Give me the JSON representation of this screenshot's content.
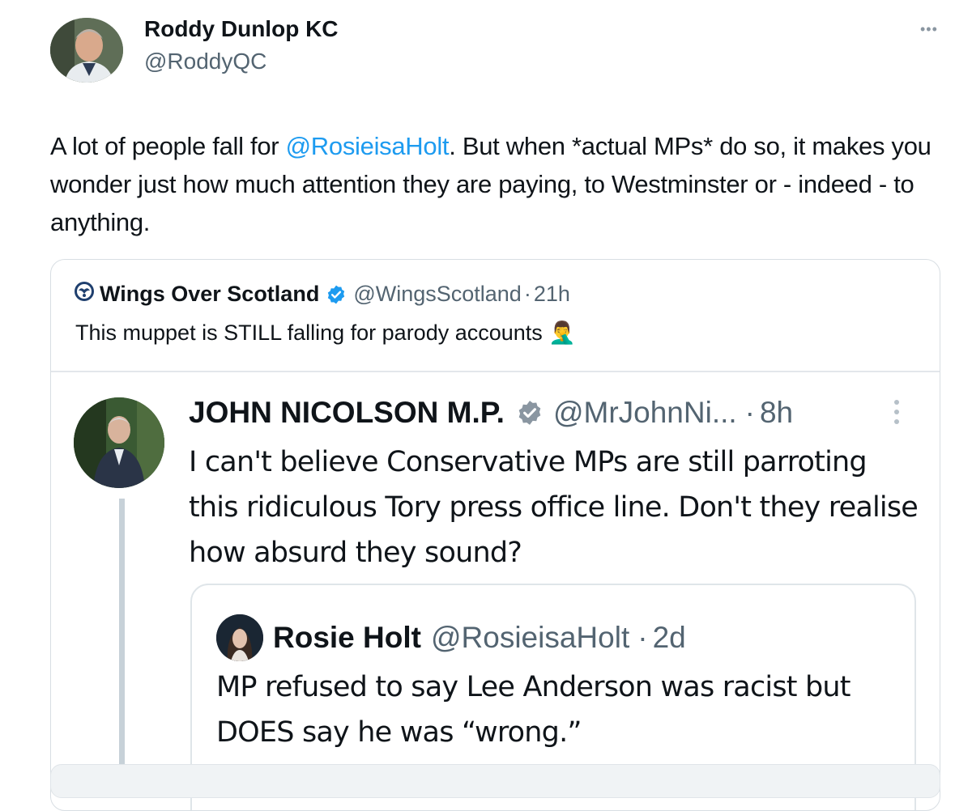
{
  "tweet": {
    "author_name": "Roddy Dunlop KC",
    "author_handle": "@RoddyQC",
    "more_icon": "more-dots-icon",
    "text_before_mention": "A lot of people fall for ",
    "mention": "@RosieisaHolt",
    "text_after_mention": ". But when *actual MPs* do so, it makes you wonder just how much attention they are paying, to Westminster or - indeed - to anything."
  },
  "quoted_tweet": {
    "author_name": "Wings Over Scotland",
    "author_handle": "@WingsScotland",
    "separator": "·",
    "time": "21h",
    "text": "This muppet is STILL falling for parody accounts",
    "emoji": "🤦‍♂️",
    "verified_color": "#1d9bf0"
  },
  "inner_tweet": {
    "author_name": "JOHN NICOLSON M.P.",
    "author_handle": "@MrJohnNi...",
    "separator": "·",
    "time": "8h",
    "verified_color": "#8a96a1",
    "text": "I can't believe Conservative MPs are still parroting this ridiculous Tory press office line. Don't they realise how absurd they sound?"
  },
  "nested_tweet": {
    "author_name": "Rosie Holt",
    "author_handle": "@RosieisaHolt",
    "separator": "·",
    "time": "2d",
    "text": "MP refused to say Lee Anderson was racist but DOES say he was “wrong.”"
  }
}
